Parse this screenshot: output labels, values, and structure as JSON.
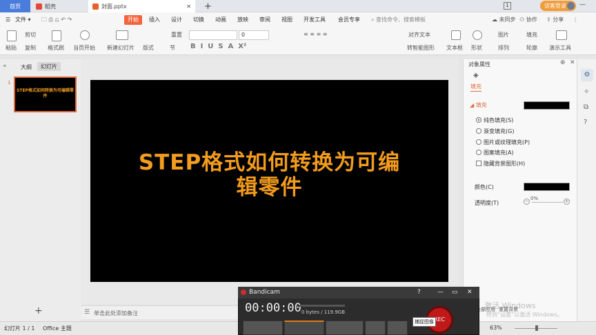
{
  "tabs": {
    "home": "首页",
    "doc": "稻壳",
    "file": "封面.pptx",
    "add": "+"
  },
  "topright": {
    "unsync": "未同步",
    "collab": "协作",
    "share": "分享",
    "login": "访客登录"
  },
  "menu": {
    "file": "文件",
    "start": "开始",
    "insert": "插入",
    "design": "设计",
    "transition": "切换",
    "animation": "动画",
    "slideshow": "放映",
    "review": "审阅",
    "view": "视图",
    "devtools": "开发工具",
    "member": "会员专享",
    "search": "查找命令、搜索模板"
  },
  "ribbon": {
    "paste": "粘贴",
    "cut": "剪切",
    "copy": "复制",
    "format": "格式刷",
    "playfrom": "当页开始",
    "newslide": "新建幻灯片",
    "layout": "版式",
    "section": "节",
    "reset": "重置",
    "fontsize": "0",
    "aligntext": "对齐文本",
    "smartart": "转智能图形",
    "textbox": "文本框",
    "shape": "形状",
    "arrange": "排列",
    "picture": "图片",
    "fill": "填充",
    "outline": "轮廓",
    "slidetools": "演示工具"
  },
  "leftpane": {
    "outline": "大纲",
    "slides": "幻灯片",
    "num": "1",
    "thumbtext": "STEP格式如何转换为可编辑零件"
  },
  "slide": {
    "title_l1": "STEP格式如何转换为可编",
    "title_l2": "辑零件"
  },
  "notes": "单击此处添加备注",
  "rightpane": {
    "title": "对象属性",
    "tab": "填充",
    "section": "填充",
    "opts": [
      "纯色填充(S)",
      "渐变填充(G)",
      "图片或纹理填充(P)",
      "图案填充(A)",
      "隐藏背景图形(H)"
    ],
    "color": "颜色(C)",
    "transparency": "透明度(T)",
    "trans_value": "0%"
  },
  "statusbar": {
    "slide": "幻灯片 1 / 1",
    "theme": "Office 主题",
    "zoom": "63%"
  },
  "bandicam": {
    "title": "Bandicam",
    "time": "00:00:00",
    "size": "0 bytes / 119.9GB",
    "rec": "REC",
    "tooltip": "捕捉图像",
    "help": "?"
  },
  "watermark": {
    "l1": "激活 Windows",
    "l2": "转到“设置”以激活 Windows。",
    "apply": "全部应用",
    "resetbg": "重置背景"
  }
}
